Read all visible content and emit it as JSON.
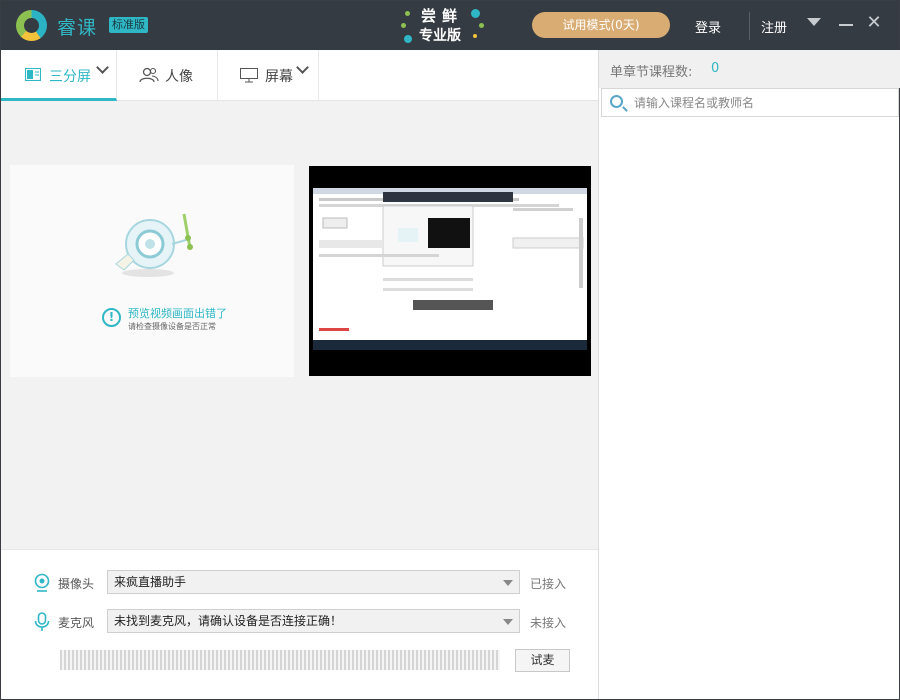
{
  "titlebar": {
    "app_name": "睿课",
    "edition": "标准版",
    "promo_line1": "尝鲜",
    "promo_line2": "专业版",
    "trial_button": "试用模式(0天)",
    "login": "登录",
    "register": "注册"
  },
  "tabs": [
    {
      "label": "三分屏",
      "icon": "layout-icon",
      "active": true,
      "has_dropdown": true
    },
    {
      "label": "人像",
      "icon": "person-icon",
      "active": false,
      "has_dropdown": false
    },
    {
      "label": "屏幕",
      "icon": "monitor-icon",
      "active": false,
      "has_dropdown": true
    }
  ],
  "camera_preview": {
    "error_title": "预览视频画面出错了",
    "error_sub": "请检查摄像设备是否正常"
  },
  "devices": {
    "camera": {
      "label": "摄像头",
      "value": "来疯直播助手",
      "status": "已接入"
    },
    "microphone": {
      "label": "麦克风",
      "value": "未找到麦克风，请确认设备是否连接正确！",
      "status": "未接入"
    },
    "test_button": "试麦"
  },
  "right_panel": {
    "course_count_label": "单章节课程数:",
    "course_count_value": "0",
    "search_placeholder": "请输入课程名或教师名"
  },
  "colors": {
    "accent": "#2fb7c6",
    "titlebar_bg": "#353b42",
    "trial_button": "#d8ac73"
  }
}
